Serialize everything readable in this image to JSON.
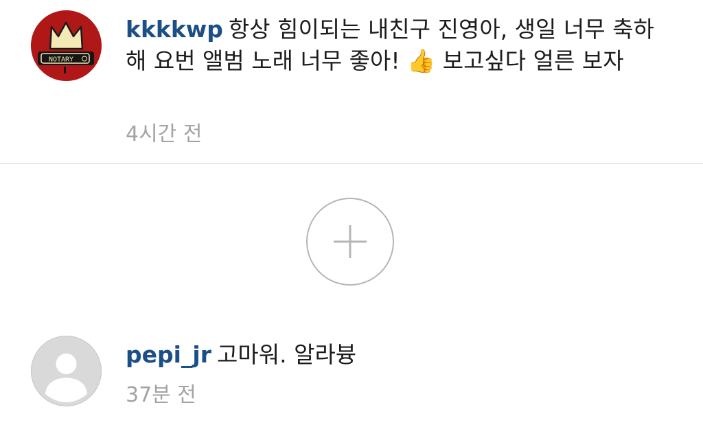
{
  "comments": [
    {
      "username": "kkkkwp",
      "text": "항상 힘이되는 내친구 진영아, 생일 너무 축하해 요번 앨범 노래 너무 좋아! 👍 보고싶다 얼른 보자",
      "timestamp": "4시간 전",
      "avatar_label": "NOTARY"
    },
    {
      "username": "pepi_jr",
      "text": "고마워. 알라븅",
      "timestamp": "37분 전"
    }
  ],
  "load_more": {
    "icon": "plus-circle-icon"
  },
  "colors": {
    "username": "#1b4f86",
    "timestamp": "#a3a3a3",
    "divider": "#dcdcdc",
    "avatar_red": "#b01818",
    "placeholder_avatar": "#d9d9d9"
  }
}
